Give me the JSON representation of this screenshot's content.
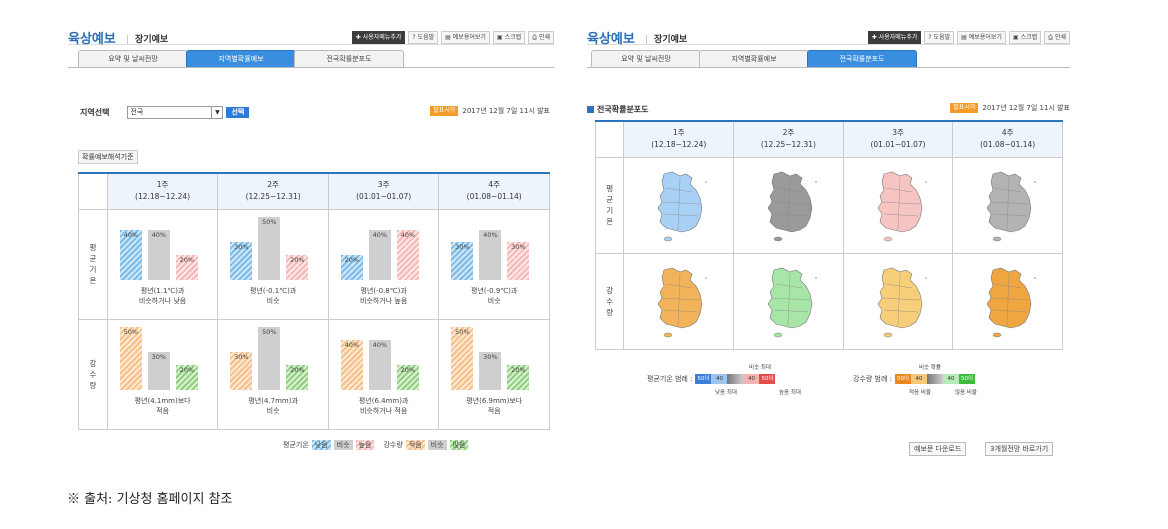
{
  "left": {
    "title": "육상예보",
    "subtitle": "장기예보",
    "tools": [
      "사용자메뉴추가",
      "도움말",
      "예보용어보기",
      "스크랩",
      "인쇄"
    ],
    "tabs": [
      "요약 및 날씨전망",
      "지역별확률예보",
      "전국확률분포도"
    ],
    "region_label": "지역선택",
    "region_value": "전국",
    "select_btn": "선택",
    "announce_badge": "발표시각",
    "announce_text": "2017년 12월 7일 11시 발표",
    "criteria_btn": "확률예보해석기준",
    "weeks": [
      {
        "wk": "1주",
        "range": "(12.18~12.24)"
      },
      {
        "wk": "2주",
        "range": "(12.25~12.31)"
      },
      {
        "wk": "3주",
        "range": "(01.01~01.07)"
      },
      {
        "wk": "4주",
        "range": "(01.08~01.14)"
      }
    ],
    "row_temp": "평균기온",
    "row_precip": "강수량",
    "temp": [
      {
        "vals": [
          40,
          40,
          20
        ],
        "labels": [
          "40%",
          "40%",
          "20%"
        ],
        "desc1": "평년(1.1℃)과",
        "desc2": "비슷하거나 낮음"
      },
      {
        "vals": [
          30,
          50,
          20
        ],
        "labels": [
          "30%",
          "50%",
          "20%"
        ],
        "desc1": "평년(-0.1℃)과",
        "desc2": "비슷"
      },
      {
        "vals": [
          20,
          40,
          40
        ],
        "labels": [
          "20%",
          "40%",
          "40%"
        ],
        "desc1": "평년(-0.8℃)과",
        "desc2": "비슷하거나 높음"
      },
      {
        "vals": [
          30,
          40,
          30
        ],
        "labels": [
          "30%",
          "40%",
          "30%"
        ],
        "desc1": "평년(-0.9℃)과",
        "desc2": "비슷"
      }
    ],
    "precip": [
      {
        "vals": [
          50,
          30,
          20
        ],
        "labels": [
          "50%",
          "30%",
          "20%"
        ],
        "desc1": "평년(4.1mm)보다",
        "desc2": "적음"
      },
      {
        "vals": [
          30,
          50,
          20
        ],
        "labels": [
          "30%",
          "50%",
          "20%"
        ],
        "desc1": "평년(4.7mm)과",
        "desc2": "비슷"
      },
      {
        "vals": [
          40,
          40,
          20
        ],
        "labels": [
          "40%",
          "40%",
          "20%"
        ],
        "desc1": "평년(6.4mm)과",
        "desc2": "비슷하거나 적음"
      },
      {
        "vals": [
          50,
          30,
          20
        ],
        "labels": [
          "50%",
          "30%",
          "20%"
        ],
        "desc1": "평년(6.9mm)보다",
        "desc2": "적음"
      }
    ],
    "legend_temp_label": "평균기온",
    "legend_temp": [
      "낮음",
      "비슷",
      "높음"
    ],
    "legend_precip_label": "강수량",
    "legend_precip": [
      "적음",
      "비슷",
      "많음"
    ]
  },
  "right": {
    "title": "육상예보",
    "subtitle": "장기예보",
    "tools": [
      "사용자메뉴추가",
      "도움말",
      "예보용어보기",
      "스크랩",
      "인쇄"
    ],
    "tabs": [
      "요약 및 날씨전망",
      "지역별확률예보",
      "전국확률분포도"
    ],
    "section_title": "전국확률분포도",
    "announce_badge": "발표시각",
    "announce_text": "2017년 12월 7일 11시 발표",
    "weeks": [
      {
        "wk": "1주",
        "range": "(12.18~12.24)"
      },
      {
        "wk": "2주",
        "range": "(12.25~12.31)"
      },
      {
        "wk": "3주",
        "range": "(01.01~01.07)"
      },
      {
        "wk": "4주",
        "range": "(01.08~01.14)"
      }
    ],
    "row_temp": "평균기온",
    "row_precip": "강수량",
    "map_colors_temp": [
      "#a9d0f5",
      "#9a9a9a",
      "#f7c4c4",
      "#b3b3b3"
    ],
    "map_colors_precip": [
      "#f2b35a",
      "#a8e6a8",
      "#f7cf7a",
      "#f0a640"
    ],
    "legend_temp_label": "평균기온 범례 :",
    "legend_temp_scale": [
      "50이상",
      "40",
      "",
      "40",
      "50이상"
    ],
    "legend_temp_top": "비슷 최대",
    "legend_temp_left": "낮음 최대",
    "legend_temp_right": "높음 최대",
    "legend_precip_label": "강수량 범례 :",
    "legend_precip_scale": [
      "50이상",
      "40",
      "",
      "40",
      "50이상"
    ],
    "legend_precip_top": "비슷 확률",
    "legend_precip_left": "적음 비율",
    "legend_precip_right": "많음 비율",
    "btn_download": "예보문 다운로드",
    "btn_3month": "3개월전망 바로가기"
  },
  "source": "※ 출처: 기상청 홈페이지 참조"
}
